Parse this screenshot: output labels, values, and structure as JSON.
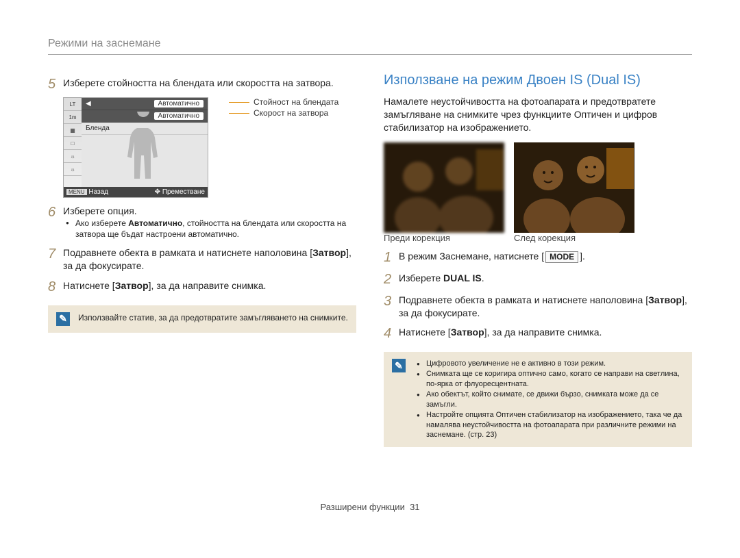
{
  "header": "Режими на заснемане",
  "left": {
    "step5": "Изберете стойността на блендата или скоростта на затвора.",
    "step6": "Изберете опция.",
    "step6_bullet": "Ако изберете <b>Автоматично</b>, стойността на блендата или скоростта на затвора ще бъдат настроени автоматично.",
    "step7": "Подравнете обекта в рамката и натиснете наполовина [<b>Затвор</b>], за да фокусирате.",
    "step8": "Натиснете [<b>Затвор</b>], за да направите снимка.",
    "lcd": {
      "row1_left": "",
      "row1_right": "Автоматично",
      "row2_left": "",
      "row2_right": "Автоматично",
      "row3": "Бленда",
      "sidebar": [
        "LT",
        "1m",
        "▦",
        "□",
        "☼",
        "☼"
      ],
      "bottom_left_key": "MENU",
      "bottom_left_label": "Назад",
      "bottom_right_icon": "✥",
      "bottom_right_label": "Преместване"
    },
    "annotations": {
      "aperture": "Стойност на блендата",
      "shutter": "Скорост на затвора"
    },
    "note": "Използвайте статив, за да предотвратите замъгляването на снимките."
  },
  "right": {
    "title": "Използване на режим Двоен IS (Dual IS)",
    "intro": "Намалете неустойчивостта на фотоапарата и предотвратете замъгляване на снимките чрез функциите Оптичен и цифров стабилизатор на изображението.",
    "before": "Преди корекция",
    "after": "След корекция",
    "step1": "В режим Заснемане, натиснете [",
    "step1_key": "MODE",
    "step1_after": "].",
    "step2": "Изберете <b>DUAL IS</b>.",
    "step3": "Подравнете обекта в рамката и натиснете наполовина [<b>Затвор</b>], за да фокусирате.",
    "step4": "Натиснете [<b>Затвор</b>], за да направите снимка.",
    "notes": [
      "Цифровото увеличение не е активно в този режим.",
      "Снимката ще се коригира оптично само, когато се направи на светлина, по-ярка от флуоресцентната.",
      "Ако обектът, който снимате, се движи бързо, снимката може да се замъгли.",
      "Настройте опцията Оптичен стабилизатор на изображението, така че да намалява неустойчивостта на фотоапарата при различните режими на заснемане. (стр. 23)"
    ]
  },
  "footer": {
    "section": "Разширени функции",
    "page": "31"
  }
}
